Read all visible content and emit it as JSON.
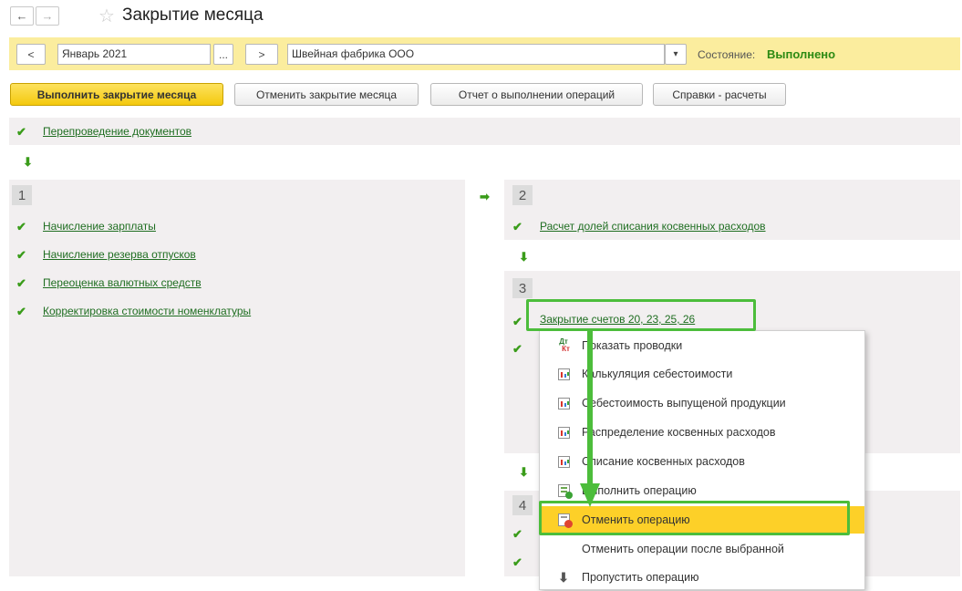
{
  "header": {
    "back": "←",
    "forward": "→",
    "title": "Закрытие месяца"
  },
  "filter": {
    "prev": "<",
    "period": "Январь 2021",
    "period_picker": "...",
    "next": ">",
    "organization": "Швейная фабрика ООО",
    "dropdown": "▾",
    "state_label": "Состояние:",
    "state_value": "Выполнено"
  },
  "toolbar": {
    "run": "Выполнить закрытие месяца",
    "cancel": "Отменить закрытие месяца",
    "report": "Отчет о выполнении операций",
    "calc": "Справки - расчеты"
  },
  "top_op": {
    "label": "Перепроведение документов"
  },
  "step1": {
    "num": "1",
    "items": [
      "Начисление зарплаты",
      "Начисление резерва отпусков",
      "Переоценка валютных средств",
      "Корректировка стоимости номенклатуры"
    ]
  },
  "step2": {
    "num": "2",
    "items": [
      "Расчет долей списания косвенных расходов"
    ]
  },
  "step3": {
    "num": "3",
    "items": [
      "Закрытие счетов 20, 23, 25, 26"
    ]
  },
  "step4": {
    "num": "4"
  },
  "context_menu": {
    "items": [
      {
        "label": "Показать проводки",
        "icon": "dt-kt-icon"
      },
      {
        "label": "Калькуляция себестоимости",
        "icon": "report-icon"
      },
      {
        "label": "Себестоимость выпущеной продукции",
        "icon": "report-icon"
      },
      {
        "label": "Распределение косвенных расходов",
        "icon": "report-icon"
      },
      {
        "label": "Списание косвенных расходов",
        "icon": "report-icon"
      },
      {
        "label": "Выполнить операцию",
        "icon": "execute-icon"
      },
      {
        "label": "Отменить операцию",
        "icon": "cancel-operation-icon"
      },
      {
        "label": "Отменить операции после выбранной",
        "icon": ""
      },
      {
        "label": "Пропустить операцию",
        "icon": "skip-arrow-icon"
      }
    ],
    "dt_icon_top": "Дт",
    "dt_icon_bottom": "Кт"
  },
  "colors": {
    "accent_yellow": "#fbed9e",
    "state_green": "#2c8a13",
    "link_green": "#1f6e21",
    "highlight": "#fdd028",
    "annotation_green": "#4cbd3b"
  }
}
